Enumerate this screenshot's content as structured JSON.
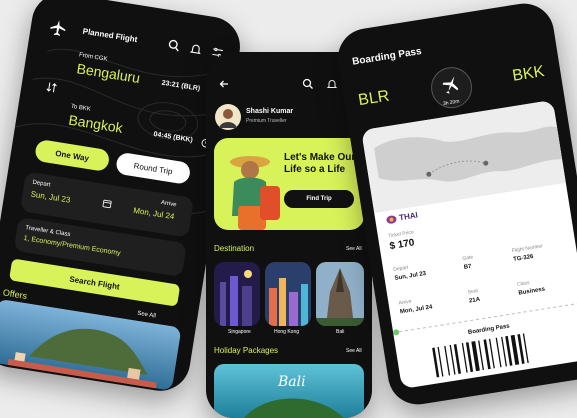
{
  "flight": {
    "header": "Planned Flight",
    "from_label": "From CGK",
    "from_city": "Bengaluru",
    "from_time": "23:21 (BLR)",
    "to_label": "To BKK",
    "to_city": "Bangkok",
    "to_time": "04:45 (BKK)",
    "one_way": "One Way",
    "round_trip": "Round Trip",
    "depart_label": "Depart",
    "depart_date": "Sun, Jul 23",
    "arrive_label": "Arrive",
    "arrive_date": "Mon, Jul 24",
    "class_label": "Traveller & Class",
    "class_value": "1, Economy/Premium Economy",
    "search_button": "Search Flight",
    "offers_title": "Offers",
    "see_all": "See All"
  },
  "home": {
    "user_name": "Shashi Kumar",
    "user_tier": "Premium Traveller",
    "promo_title": "Let's Make Our Life so a Life",
    "find_trip": "Find Trip",
    "destination_title": "Destination",
    "destination_see_all": "See All",
    "destinations": [
      "Singapore",
      "Hong Kong",
      "Bali"
    ],
    "packages_title": "Holiday Packages",
    "packages_see_all": "See All",
    "package_banner": "Bali"
  },
  "pass": {
    "title": "Boarding Pass",
    "origin": "BLR",
    "destination": "BKK",
    "duration": "3h 20m",
    "airline": "THAI",
    "ticket_label": "Ticket Price",
    "ticket_price": "$ 170",
    "depart_label": "Depart",
    "depart_date": "Sun, Jul 23",
    "gate_label": "Gate",
    "gate_value": "B7",
    "flight_label": "Flight Number",
    "flight_value": "TG-326",
    "arrive_label": "Arrive",
    "arrive_date": "Mon, Jul 24",
    "seat_label": "Seat",
    "seat_value": "21A",
    "class_label": "Class",
    "class_value": "Business",
    "footer": "Boarding Pass"
  },
  "colors": {
    "accent": "#d8f25a",
    "dark": "#101010",
    "card": "#1f1f1f"
  }
}
